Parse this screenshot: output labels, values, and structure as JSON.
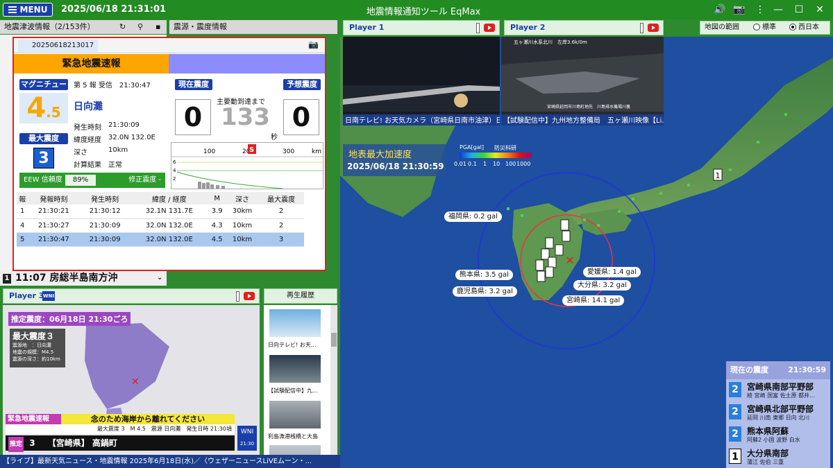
{
  "topbar": {
    "menu": "MENU",
    "clock": "2025/06/18 21:31:01",
    "title": "地震情報通知ツール EqMax"
  },
  "left_tabs": {
    "info": "地震津波情報（2/153件）",
    "source": "震源・震度情報"
  },
  "list_item": {
    "time": "11:07",
    "place": "房総半島南方沖",
    "int": "1"
  },
  "eew": {
    "id": "20250618213017",
    "banner": "緊急地震速報",
    "mag_label": "マグニチュード",
    "mag_int": "4",
    "mag_dec": ".5",
    "report": "第 5 報 受信　21:30:47",
    "epicenter": "日向灘",
    "origin_label": "発生時刻",
    "origin": "21:30:09",
    "latlon_label": "緯度経度",
    "latlon": "32.0N 132.0E",
    "depth_label": "深さ",
    "depth": "10km",
    "calc_label": "計算結果",
    "calc": "正常",
    "maxint_label": "最大震度",
    "maxint": "3",
    "conf_label": "EEW 信頼度",
    "conf": "89%",
    "corr": "修正震度 -",
    "cur_label": "現在震度",
    "cur": "0",
    "fcst_label": "予想震度",
    "fcst": "0",
    "countdown_label": "主要動到達まで",
    "countdown": "133",
    "countdown_unit": "秒",
    "graph": {
      "ticks": [
        "100",
        "200",
        "300"
      ],
      "unit": "km",
      "marker": "S",
      "yticks": [
        "6",
        "4",
        "2"
      ]
    },
    "table": {
      "headers": [
        "報",
        "発報時刻",
        "発生時刻",
        "緯度 / 経度",
        "M",
        "深さ",
        "最大震度"
      ],
      "rows": [
        [
          "1",
          "21:30:21",
          "21:30:12",
          "32.1N 131.7E",
          "3.9",
          "30km",
          "2"
        ],
        [
          "4",
          "21:30:27",
          "21:30:09",
          "32.0N 132.0E",
          "4.3",
          "10km",
          "2"
        ],
        [
          "5",
          "21:30:47",
          "21:30:09",
          "32.0N 132.0E",
          "4.5",
          "10km",
          "3"
        ]
      ]
    }
  },
  "players": {
    "p1": "Player 1",
    "p2": "Player 2",
    "p3": "Player 3",
    "v1_caption": "日南テレビ! お天気カメラ（宮崎県日南市油津）日...",
    "v2_caption": "【試験配信中】九州地方整備局　五ヶ瀬川映像【Li...",
    "v2_overlay": "五ヶ瀬川水系北川　左岸3.6k/0m",
    "v2_bottom": "宮崎県延岡市川島町地先　川島排水機場川裏",
    "v3_caption": "【ライブ】最新天気ニュース・地震情報 2025年6月18日(水)／〈ウェザーニュースLiVEムーン・..."
  },
  "map": {
    "pga_title": "地表最大加速度",
    "pga_time": "2025/06/18 21:30:59",
    "scale_title": "PGA[gal]",
    "scale_brand": "防災科研",
    "scale_ticks": [
      "0.01",
      "0.1",
      "1",
      "10",
      "100",
      "1000"
    ],
    "gal_labels": {
      "fukuoka": "福岡県: 0.2 gal",
      "kumamoto": "熊本県: 3.5 gal",
      "kagoshima": "鹿児島県: 3.2 gal",
      "ehime": "愛媛県: 1.4 gal",
      "oita": "大分県: 3.2 gal",
      "miyazaki": "宮崎県: 14.1 gal"
    },
    "region_label": "地図の範囲",
    "region_std": "標準",
    "region_west": "西日本",
    "far_marker": "1"
  },
  "current": {
    "title": "現在の震度",
    "time": "21:30:59",
    "rows": [
      {
        "int": "2",
        "name": "宮崎県南部平野部",
        "sub": "綾 宮崎 国富 佐土原 都井...",
        "color": "#2a7fd8"
      },
      {
        "int": "2",
        "name": "宮崎県北部平野部",
        "sub": "延岡 川南 東郷 日向 北川",
        "color": "#2a7fd8"
      },
      {
        "int": "2",
        "name": "熊本県阿蘇",
        "sub": "阿蘇2 小国 波野 白水",
        "color": "#2a7fd8"
      },
      {
        "int": "1",
        "name": "大分県南部",
        "sub": "蒲江 佐伯 三重",
        "color": "#ffffff"
      }
    ]
  },
  "nhk": {
    "est": "推定震度：06月18日 21:30ごろ",
    "maxint": "最大震度３",
    "l1": "震源地　：日向灘",
    "l2": "地震の規模：M4.5",
    "l3": "震源の深さ：約10km",
    "alert_tag": "緊急地震速報",
    "alert_msg": "念のため海岸から離れてください",
    "line2": "最大震度 3　M 4.5　震源 日向灘　発生日時 21:30頃",
    "tag": "推定",
    "int": "3",
    "region": "【宮崎県】 高鍋町",
    "logo": "WNI",
    "clock": "21:30"
  },
  "history": {
    "title": "再生履歴",
    "items": [
      {
        "caption": "日向テレビ! お天..."
      },
      {
        "caption": "【試験配信中】九..."
      },
      {
        "caption": "利島漁港桟橋と大島"
      },
      {
        "caption": ""
      }
    ]
  }
}
